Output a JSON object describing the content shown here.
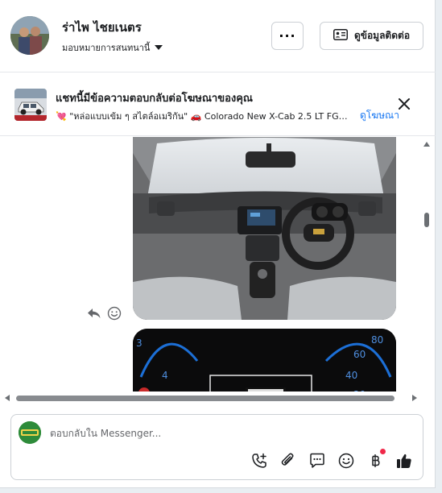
{
  "header": {
    "contact_name": "ร่าไพ ไชยเนตร",
    "assign_label": "มอบหมายการสนทนานี้",
    "more_label": "···",
    "contact_info_label": "ดูข้อมูลติดต่อ"
  },
  "banner": {
    "title": "แชทนี้มีข้อความตอบกลับต่อโฆษณาของคุณ",
    "subtitle": "💘 \"หล่อแบบเข้ม ๆ สไตล์อเมริกัน\" 🚗 Colorado New X-Cab 2.5 LT FG…",
    "view_ad_label": "ดูโฆษณา"
  },
  "composer": {
    "placeholder": "ตอบกลับใน Messenger..."
  },
  "colors": {
    "accent": "#1877f2",
    "notification": "#f02849",
    "border": "#ccd0d5"
  },
  "icons": [
    "chevron-down-icon",
    "contact-card-icon",
    "close-icon",
    "reply-icon",
    "emoji-icon",
    "add-call-icon",
    "attach-icon",
    "saved-reply-icon",
    "emoji-icon",
    "baht-payment-icon",
    "thumbs-up-icon"
  ]
}
